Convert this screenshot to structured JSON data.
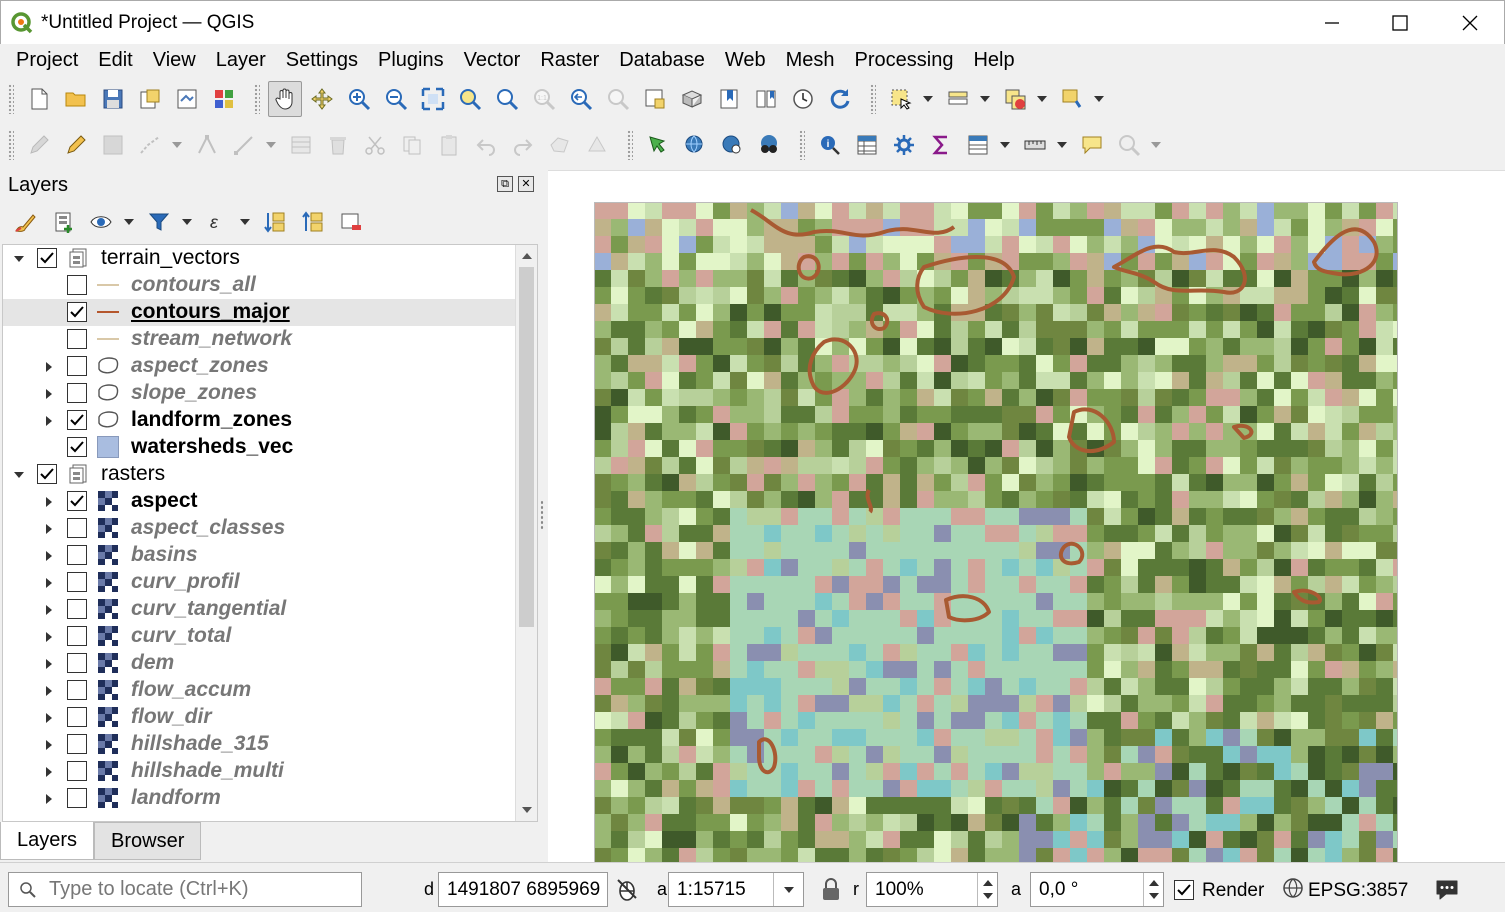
{
  "window": {
    "title": "*Untitled Project — QGIS",
    "minimize_icon": "minimize-icon",
    "maximize_icon": "maximize-icon",
    "close_icon": "close-icon"
  },
  "menu": [
    "Project",
    "Edit",
    "View",
    "Layer",
    "Settings",
    "Plugins",
    "Vector",
    "Raster",
    "Database",
    "Web",
    "Mesh",
    "Processing",
    "Help"
  ],
  "layers_panel": {
    "title": "Layers",
    "layers": [
      {
        "name": "terrain_vectors",
        "type": "group",
        "checked": true,
        "expanded": true,
        "style": "normal",
        "indent": 0
      },
      {
        "name": "contours_all",
        "type": "line",
        "checked": false,
        "style": "italic",
        "indent": 1,
        "color": "#d9c8a8"
      },
      {
        "name": "contours_major",
        "type": "line",
        "checked": true,
        "style": "bold-underline",
        "indent": 1,
        "color": "#b5572d",
        "selected": true
      },
      {
        "name": "stream_network",
        "type": "line",
        "checked": false,
        "style": "italic",
        "indent": 1,
        "color": "#d9c8a8"
      },
      {
        "name": "aspect_zones",
        "type": "polygon-outline",
        "checked": false,
        "style": "italic",
        "indent": 1,
        "expandable": true
      },
      {
        "name": "slope_zones",
        "type": "polygon-outline",
        "checked": false,
        "style": "italic",
        "indent": 1,
        "expandable": true
      },
      {
        "name": "landform_zones",
        "type": "polygon-outline",
        "checked": true,
        "style": "bold",
        "indent": 1,
        "expandable": true
      },
      {
        "name": "watersheds_vec",
        "type": "polygon-fill",
        "checked": true,
        "style": "bold",
        "indent": 1,
        "color": "#a9bde0"
      },
      {
        "name": "rasters",
        "type": "group",
        "checked": true,
        "expanded": true,
        "style": "normal",
        "indent": 0
      },
      {
        "name": "aspect",
        "type": "raster",
        "checked": true,
        "style": "bold",
        "indent": 1,
        "expandable": true
      },
      {
        "name": "aspect_classes",
        "type": "raster",
        "checked": false,
        "style": "italic",
        "indent": 1,
        "expandable": true
      },
      {
        "name": "basins",
        "type": "raster",
        "checked": false,
        "style": "italic",
        "indent": 1,
        "expandable": true
      },
      {
        "name": "curv_profil",
        "type": "raster",
        "checked": false,
        "style": "italic",
        "indent": 1,
        "expandable": true
      },
      {
        "name": "curv_tangential",
        "type": "raster",
        "checked": false,
        "style": "italic",
        "indent": 1,
        "expandable": true
      },
      {
        "name": "curv_total",
        "type": "raster",
        "checked": false,
        "style": "italic",
        "indent": 1,
        "expandable": true
      },
      {
        "name": "dem",
        "type": "raster",
        "checked": false,
        "style": "italic",
        "indent": 1,
        "expandable": true
      },
      {
        "name": "flow_accum",
        "type": "raster",
        "checked": false,
        "style": "italic",
        "indent": 1,
        "expandable": true
      },
      {
        "name": "flow_dir",
        "type": "raster",
        "checked": false,
        "style": "italic",
        "indent": 1,
        "expandable": true
      },
      {
        "name": "hillshade_315",
        "type": "raster",
        "checked": false,
        "style": "italic",
        "indent": 1,
        "expandable": true
      },
      {
        "name": "hillshade_multi",
        "type": "raster",
        "checked": false,
        "style": "italic",
        "indent": 1,
        "expandable": true
      },
      {
        "name": "landform",
        "type": "raster",
        "checked": false,
        "style": "italic",
        "indent": 1,
        "expandable": true
      }
    ]
  },
  "tabs": {
    "layers": "Layers",
    "browser": "Browser"
  },
  "statusbar": {
    "locator_placeholder": "Type to locate (Ctrl+K)",
    "coordinate_label": "d",
    "coordinate": "1491807  6895969",
    "scale_label": "a",
    "scale": "1:15715",
    "magnifier_label": "r",
    "magnifier": "100%",
    "rotation_label": "a",
    "rotation": "0,0 °",
    "render_label": "Render",
    "render_checked": true,
    "crs": "EPSG:3857"
  },
  "map": {
    "colors": [
      "#5a7a38",
      "#7a9a4e",
      "#9ab874",
      "#b7d09a",
      "#c9e0b0",
      "#e2f5c8",
      "#a8d6b5",
      "#7ec8c8",
      "#8a8fb0",
      "#d2a59a",
      "#e8b4a8",
      "#3f5a2a",
      "#6f8640",
      "#c0b38a",
      "#9ab0d8"
    ],
    "contour_color": "#a85a32"
  }
}
